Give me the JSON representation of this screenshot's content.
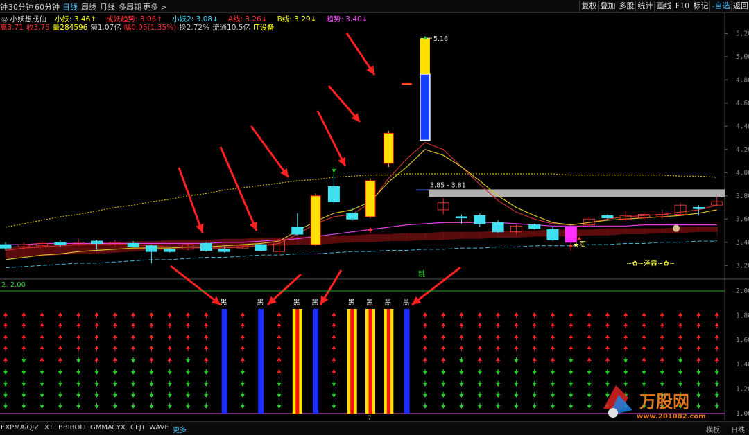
{
  "toolbar": {
    "left_tabs": [
      {
        "label": "钟",
        "x": 0
      },
      {
        "label": "30分钟",
        "x": 12
      },
      {
        "label": "60分钟",
        "x": 50
      },
      {
        "label": "日线",
        "x": 90,
        "active": true
      },
      {
        "label": "周线",
        "x": 117
      },
      {
        "label": "月线",
        "x": 144
      },
      {
        "label": "多周期",
        "x": 171
      },
      {
        "label": "更多 >",
        "x": 206
      }
    ],
    "right_buttons": [
      "复权",
      "叠加",
      "多股",
      "统计",
      "画线",
      "F10",
      "标记",
      "-自选",
      "返回"
    ]
  },
  "info_line1": {
    "title": "小妖想成仙",
    "items": [
      {
        "text": "小妖: 3.46↑",
        "color": "#ffff00"
      },
      {
        "text": "成妖趋势: 3.06↑",
        "color": "#ff3030"
      },
      {
        "text": "小妖2: 3.08↓",
        "color": "#40d8ff"
      },
      {
        "text": "A线: 3.26↓",
        "color": "#ff3030"
      },
      {
        "text": "B线: 3.29↓",
        "color": "#ffff00"
      },
      {
        "text": "趋势: 3.40↓",
        "color": "#ff40ff"
      }
    ]
  },
  "info_line2": {
    "items": [
      {
        "text": "高3.71",
        "color": "#ff3030"
      },
      {
        "text": "收3.75",
        "color": "#ff3030"
      },
      {
        "text": "量284596",
        "color": "#ffff00"
      },
      {
        "text": "额1.07亿",
        "color": "#cccccc"
      },
      {
        "text": "幅0.05(1.35%)",
        "color": "#ff3030"
      },
      {
        "text": "换2.72%",
        "color": "#cccccc"
      },
      {
        "text": "流通10.5亿",
        "color": "#cccccc"
      },
      {
        "text": "IT设备",
        "color": "#ffff00"
      }
    ]
  },
  "price_axis": [
    "5.20",
    "5.00",
    "4.80",
    "4.60",
    "4.40",
    "4.20",
    "4.00",
    "3.80",
    "3.60",
    "3.40",
    "3.20"
  ],
  "indicator_axis": [
    "2.00",
    "1.80",
    "1.60",
    "1.40",
    "1.20",
    "1.00"
  ],
  "annotations": {
    "high_label": "5.16",
    "band_label": "3.85 - 3.81",
    "buy_label": "★买",
    "jump_label": "跳",
    "brand_label": "~✿~泽霖~✿~",
    "indicator_title": "2. 2.00",
    "hei_label": "黑",
    "page_num": "7"
  },
  "bottom_tabs": [
    {
      "label": "EXPMA",
      "active": false
    },
    {
      "label": "SQJZ",
      "active": false
    },
    {
      "label": "XT",
      "active": false
    },
    {
      "label": "BBIBOLL",
      "active": false
    },
    {
      "label": "GMMA",
      "active": false
    },
    {
      "label": "CYX",
      "active": false
    },
    {
      "label": "CFJT",
      "active": false
    },
    {
      "label": "WAVE",
      "active": false
    },
    {
      "label": "更多",
      "active": true
    }
  ],
  "bottom_right": {
    "period_label": "日线",
    "mode_label": "横板"
  },
  "watermark": {
    "brand": "万股网",
    "url": "www.201082.com"
  },
  "chart_data": {
    "type": "candlestick",
    "ylim": [
      3.1,
      5.25
    ],
    "candles": [
      {
        "o": 3.38,
        "c": 3.35,
        "h": 3.4,
        "l": 3.33,
        "color": "cyan"
      },
      {
        "o": 3.36,
        "c": 3.38,
        "h": 3.4,
        "l": 3.34,
        "color": "red"
      },
      {
        "o": 3.37,
        "c": 3.39,
        "h": 3.41,
        "l": 3.35,
        "color": "red"
      },
      {
        "o": 3.4,
        "c": 3.38,
        "h": 3.42,
        "l": 3.36,
        "color": "cyan"
      },
      {
        "o": 3.38,
        "c": 3.4,
        "h": 3.43,
        "l": 3.37,
        "color": "red"
      },
      {
        "o": 3.41,
        "c": 3.39,
        "h": 3.42,
        "l": 3.33,
        "color": "cyan"
      },
      {
        "o": 3.38,
        "c": 3.4,
        "h": 3.42,
        "l": 3.37,
        "color": "red"
      },
      {
        "o": 3.39,
        "c": 3.36,
        "h": 3.41,
        "l": 3.35,
        "color": "cyan"
      },
      {
        "o": 3.37,
        "c": 3.32,
        "h": 3.38,
        "l": 3.22,
        "color": "cyan"
      },
      {
        "o": 3.34,
        "c": 3.32,
        "h": 3.35,
        "l": 3.31,
        "color": "cyan"
      },
      {
        "o": 3.34,
        "c": 3.38,
        "h": 3.39,
        "l": 3.33,
        "color": "red"
      },
      {
        "o": 3.39,
        "c": 3.33,
        "h": 3.4,
        "l": 3.32,
        "color": "cyan"
      },
      {
        "o": 3.34,
        "c": 3.32,
        "h": 3.36,
        "l": 3.31,
        "color": "cyan"
      },
      {
        "o": 3.35,
        "c": 3.37,
        "h": 3.38,
        "l": 3.34,
        "color": "red"
      },
      {
        "o": 3.38,
        "c": 3.33,
        "h": 3.39,
        "l": 3.32,
        "color": "cyan"
      },
      {
        "o": 3.32,
        "c": 3.42,
        "h": 3.43,
        "l": 3.29,
        "color": "red"
      },
      {
        "o": 3.53,
        "c": 3.47,
        "h": 3.65,
        "l": 3.46,
        "color": "cyan"
      },
      {
        "o": 3.38,
        "c": 3.8,
        "h": 3.82,
        "l": 3.37,
        "color": "yellow"
      },
      {
        "o": 3.88,
        "c": 3.75,
        "h": 3.98,
        "l": 3.72,
        "color": "cyan"
      },
      {
        "o": 3.65,
        "c": 3.6,
        "h": 3.7,
        "l": 3.58,
        "color": "cyan"
      },
      {
        "o": 3.62,
        "c": 3.93,
        "h": 3.95,
        "l": 3.61,
        "color": "yellow"
      },
      {
        "o": 4.08,
        "c": 4.34,
        "h": 4.36,
        "l": 4.05,
        "color": "yellow"
      },
      {
        "o": 4.77,
        "c": 4.77,
        "h": 4.77,
        "l": 4.77,
        "color": "yellow"
      },
      {
        "o": 4.85,
        "c": 4.28,
        "h": 5.16,
        "l": 4.27,
        "color": "blue"
      },
      {
        "o": 3.74,
        "c": 3.68,
        "h": 3.78,
        "l": 3.64,
        "color": "red"
      },
      {
        "o": 3.62,
        "c": 3.61,
        "h": 3.64,
        "l": 3.56,
        "color": "cyan"
      },
      {
        "o": 3.63,
        "c": 3.56,
        "h": 3.65,
        "l": 3.53,
        "color": "cyan"
      },
      {
        "o": 3.57,
        "c": 3.49,
        "h": 3.59,
        "l": 3.48,
        "color": "cyan"
      },
      {
        "o": 3.54,
        "c": 3.49,
        "h": 3.56,
        "l": 3.47,
        "color": "red"
      },
      {
        "o": 3.55,
        "c": 3.52,
        "h": 3.56,
        "l": 3.51,
        "color": "cyan"
      },
      {
        "o": 3.51,
        "c": 3.42,
        "h": 3.53,
        "l": 3.41,
        "color": "cyan"
      },
      {
        "o": 3.4,
        "c": 3.53,
        "h": 3.55,
        "l": 3.38,
        "color": "magenta"
      },
      {
        "o": 3.55,
        "c": 3.6,
        "h": 3.62,
        "l": 3.53,
        "color": "red"
      },
      {
        "o": 3.61,
        "c": 3.63,
        "h": 3.64,
        "l": 3.59,
        "color": "cyan"
      },
      {
        "o": 3.6,
        "c": 3.63,
        "h": 3.67,
        "l": 3.58,
        "color": "red"
      },
      {
        "o": 3.61,
        "c": 3.64,
        "h": 3.65,
        "l": 3.59,
        "color": "red"
      },
      {
        "o": 3.62,
        "c": 3.64,
        "h": 3.68,
        "l": 3.6,
        "color": "red"
      },
      {
        "o": 3.64,
        "c": 3.72,
        "h": 3.74,
        "l": 3.63,
        "color": "red"
      },
      {
        "o": 3.69,
        "c": 3.7,
        "h": 3.72,
        "l": 3.63,
        "color": "cyan"
      },
      {
        "o": 3.72,
        "c": 3.75,
        "h": 3.8,
        "l": 3.71,
        "color": "red"
      }
    ],
    "line_yellow": [
      3.25,
      3.27,
      3.29,
      3.3,
      3.32,
      3.33,
      3.34,
      3.35,
      3.35,
      3.35,
      3.36,
      3.36,
      3.37,
      3.38,
      3.39,
      3.41,
      3.5,
      3.58,
      3.65,
      3.68,
      3.75,
      3.92,
      4.05,
      4.2,
      4.15,
      4.05,
      3.93,
      3.8,
      3.7,
      3.63,
      3.57,
      3.55,
      3.57,
      3.59,
      3.6,
      3.61,
      3.62,
      3.63,
      3.65,
      3.68
    ],
    "line_red": [
      3.33,
      3.35,
      3.36,
      3.37,
      3.38,
      3.38,
      3.38,
      3.38,
      3.37,
      3.36,
      3.36,
      3.35,
      3.35,
      3.36,
      3.37,
      3.39,
      3.47,
      3.56,
      3.62,
      3.64,
      3.74,
      3.95,
      4.12,
      4.26,
      4.2,
      4.05,
      3.9,
      3.76,
      3.66,
      3.6,
      3.56,
      3.55,
      3.57,
      3.6,
      3.62,
      3.63,
      3.64,
      3.66,
      3.68,
      3.72
    ],
    "line_magenta": [
      3.38,
      3.38,
      3.39,
      3.39,
      3.39,
      3.39,
      3.39,
      3.39,
      3.39,
      3.39,
      3.39,
      3.39,
      3.4,
      3.4,
      3.41,
      3.42,
      3.43,
      3.45,
      3.47,
      3.49,
      3.51,
      3.53,
      3.55,
      3.56,
      3.57,
      3.57,
      3.57,
      3.57,
      3.56,
      3.55,
      3.54,
      3.54,
      3.54,
      3.54,
      3.54,
      3.55,
      3.55,
      3.55,
      3.55,
      3.55
    ],
    "line_dotted_yellow": [
      3.53,
      3.56,
      3.59,
      3.62,
      3.64,
      3.67,
      3.7,
      3.72,
      3.75,
      3.77,
      3.8,
      3.82,
      3.85,
      3.87,
      3.89,
      3.91,
      3.93,
      3.94,
      3.96,
      3.97,
      3.98,
      3.98,
      3.99,
      3.99,
      3.99,
      3.99,
      3.99,
      3.99,
      3.99,
      3.99,
      3.99,
      3.98,
      3.98,
      3.98,
      3.98,
      3.98,
      3.98,
      3.97,
      3.97,
      3.96
    ],
    "band_upper": [
      3.36,
      3.37,
      3.38,
      3.39,
      3.39,
      3.4,
      3.4,
      3.41,
      3.41,
      3.42,
      3.42,
      3.42,
      3.43,
      3.43,
      3.44,
      3.44,
      3.45,
      3.45,
      3.46,
      3.46,
      3.47,
      3.47,
      3.48,
      3.48,
      3.49,
      3.49,
      3.49,
      3.5,
      3.5,
      3.5,
      3.51,
      3.51,
      3.51,
      3.52,
      3.52,
      3.52,
      3.52,
      3.53,
      3.53,
      3.53
    ],
    "band_lower": [
      3.18,
      3.19,
      3.2,
      3.21,
      3.22,
      3.22,
      3.23,
      3.24,
      3.25,
      3.25,
      3.26,
      3.27,
      3.27,
      3.28,
      3.29,
      3.29,
      3.3,
      3.3,
      3.31,
      3.32,
      3.32,
      3.33,
      3.33,
      3.34,
      3.34,
      3.35,
      3.35,
      3.36,
      3.36,
      3.37,
      3.37,
      3.37,
      3.38,
      3.38,
      3.39,
      3.39,
      3.4,
      3.4,
      3.41,
      3.41
    ],
    "resistance_band": [
      3.81,
      3.85
    ],
    "indicator": {
      "hei_columns": [
        12,
        14,
        16,
        17,
        19,
        20,
        21,
        22
      ],
      "hei_styles": [
        "blue",
        "blue",
        "yellowred",
        "blue",
        "yellowred",
        "yellowred",
        "yellowred",
        "blue"
      ]
    }
  }
}
